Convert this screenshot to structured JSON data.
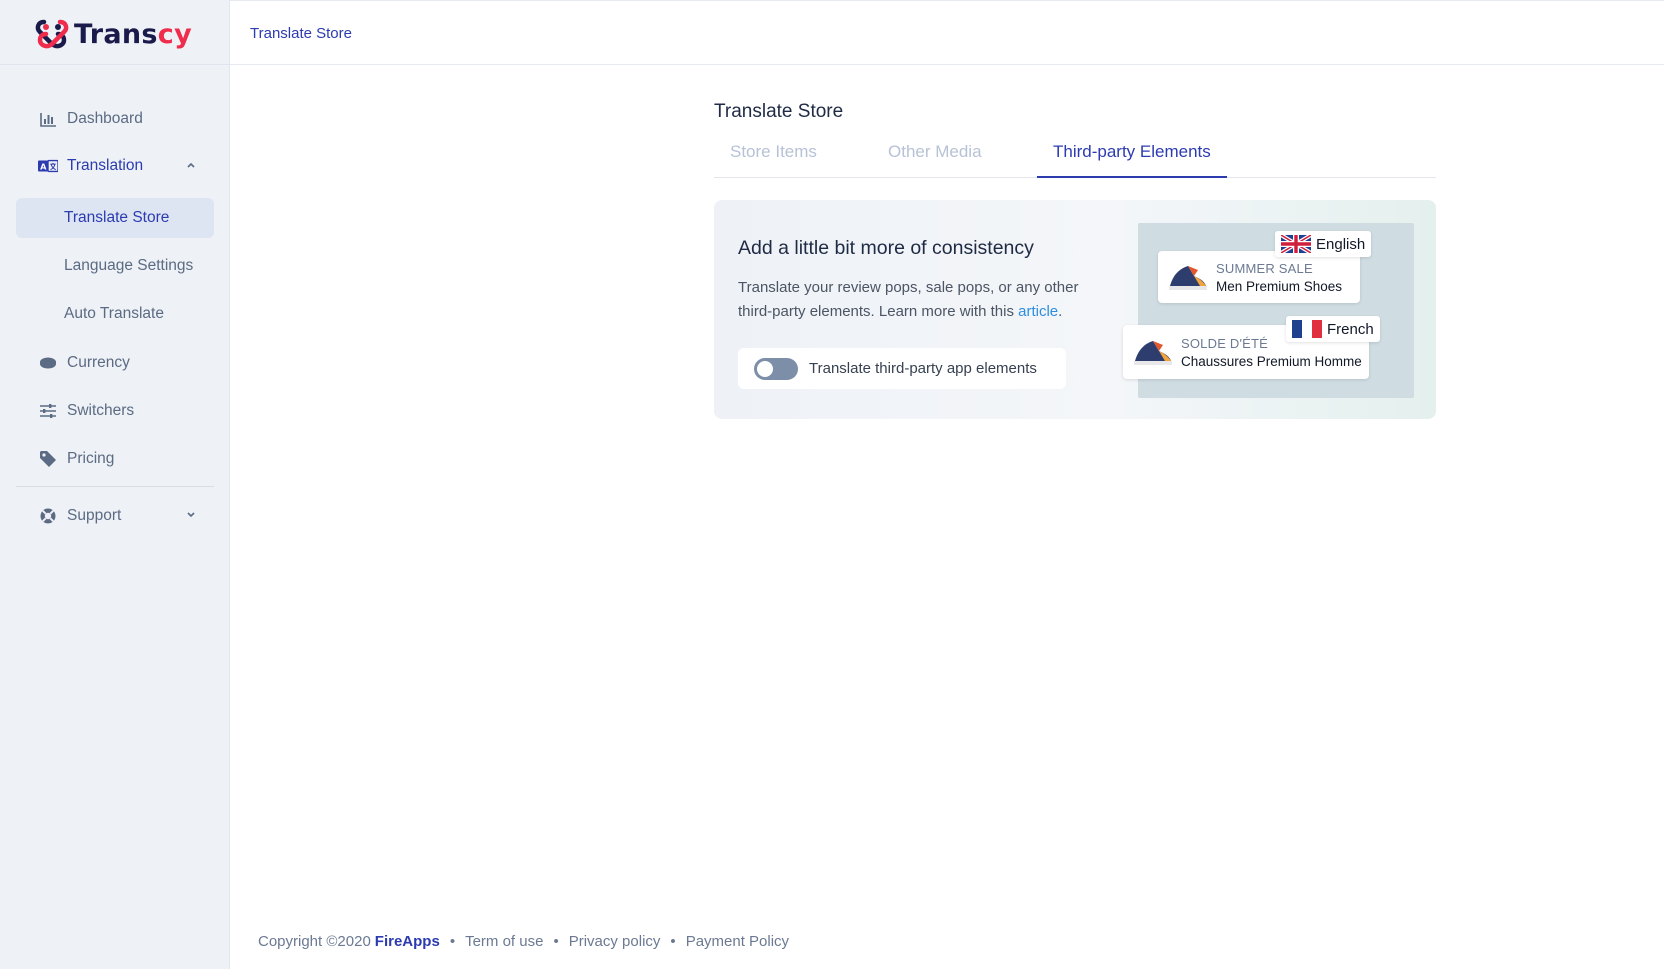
{
  "app": {
    "logo_part1": "Trans",
    "logo_part2": "cy",
    "brand_color": "#ef2c4b",
    "accent_color": "#2c3bb0"
  },
  "header": {
    "breadcrumb": "Translate Store"
  },
  "sidebar": {
    "items": [
      {
        "label": "Dashboard",
        "icon": "bar-chart-icon"
      },
      {
        "label": "Translation",
        "icon": "translate-icon",
        "expanded": true,
        "children": [
          {
            "label": "Translate Store",
            "active": true
          },
          {
            "label": "Language Settings"
          },
          {
            "label": "Auto Translate"
          }
        ]
      },
      {
        "label": "Currency",
        "icon": "coin-icon"
      },
      {
        "label": "Switchers",
        "icon": "sliders-icon"
      },
      {
        "label": "Pricing",
        "icon": "tag-icon"
      },
      {
        "label": "Support",
        "icon": "lifebuoy-icon",
        "expanded": false
      }
    ]
  },
  "main": {
    "title": "Translate Store",
    "tabs": [
      {
        "label": "Store Items",
        "active": false
      },
      {
        "label": "Other Media",
        "active": false
      },
      {
        "label": "Third-party Elements",
        "active": true
      }
    ],
    "card": {
      "title": "Add a little bit more of consistency",
      "description_prefix": "Translate your review pops, sale pops, or any other third-party elements. Learn more with this ",
      "link_text": "article",
      "description_suffix": ".",
      "toggle_label": "Translate third-party app elements",
      "toggle_on": false,
      "illustration": {
        "english_label": "English",
        "english_pop_title": "SUMMER SALE",
        "english_pop_subtitle": "Men Premium Shoes",
        "french_label": "French",
        "french_pop_title": "SOLDE D'ÉTÉ",
        "french_pop_subtitle": "Chaussures Premium Homme"
      }
    }
  },
  "footer": {
    "copyright": "Copyright ©2020",
    "brand": "FireApps",
    "links": [
      "Term of use",
      "Privacy policy",
      "Payment Policy"
    ]
  }
}
